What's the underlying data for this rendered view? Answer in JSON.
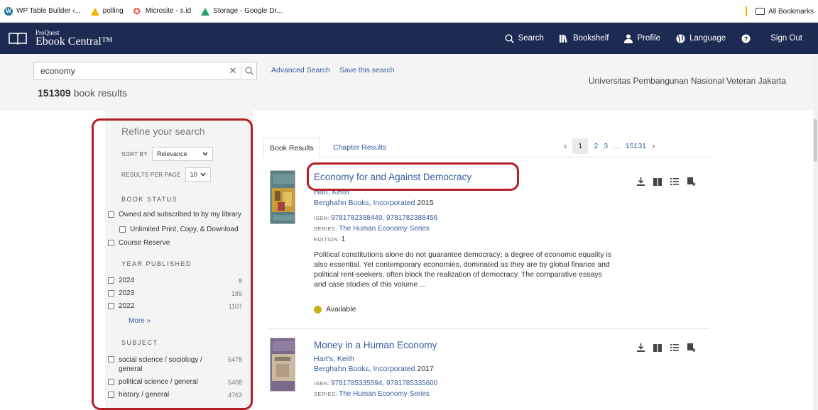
{
  "bookmarks": {
    "items": [
      {
        "label": "WP Table Builder ‹...",
        "icon": "wordpress-icon"
      },
      {
        "label": "polling",
        "icon": "google-drive-icon"
      },
      {
        "label": "Microsite - s.id",
        "icon": "pin-icon"
      },
      {
        "label": "Storage - Google Dr...",
        "icon": "google-drive-icon"
      }
    ],
    "all_bookmarks": "All Bookmarks"
  },
  "header": {
    "brand_small": "ProQuest",
    "brand_big": "Ebook Central™",
    "nav": {
      "search": "Search",
      "bookshelf": "Bookshelf",
      "profile": "Profile",
      "language": "Language",
      "sign_out": "Sign Out"
    },
    "bg_color": "#1d2a52"
  },
  "search": {
    "query": "economy",
    "advanced": "Advanced Search",
    "save": "Save this search",
    "count": "151309",
    "count_suffix": " book results",
    "institution": "Universitas Pembangunan Nasional Veteran Jakarta"
  },
  "refine": {
    "title": "Refine your search",
    "sort_label": "SORT BY",
    "sort_value": "Relevance",
    "rpp_label": "RESULTS PER PAGE",
    "rpp_value": "10",
    "book_status": {
      "heading": "BOOK STATUS",
      "owned": "Owned and subscribed to by my library",
      "unlimited": "Unlimited Print, Copy, & Download",
      "reserve": "Course Reserve"
    },
    "year": {
      "heading": "YEAR PUBLISHED",
      "items": [
        {
          "label": "2024",
          "count": "8"
        },
        {
          "label": "2023",
          "count": "189"
        },
        {
          "label": "2022",
          "count": "1107"
        }
      ],
      "more": "More »"
    },
    "subject": {
      "heading": "SUBJECT",
      "items": [
        {
          "label": "social science / sociology / general",
          "count": "5478"
        },
        {
          "label": "political science / general",
          "count": "5408"
        },
        {
          "label": "history / general",
          "count": "4763"
        }
      ]
    }
  },
  "tabs": {
    "book": "Book Results",
    "chapter": "Chapter Results"
  },
  "pager": {
    "prev": "‹",
    "pages": [
      "1",
      "2",
      "3"
    ],
    "ellipsis": "...",
    "last": "15131",
    "next": "›"
  },
  "results": [
    {
      "title": "Economy for and Against Democracy",
      "author": "Hart, Keith",
      "publisher": "Berghahn Books, Incorporated",
      "year": "2015",
      "isbn_label": "ISBN:",
      "isbn": "9781782388449, 9781782388456",
      "series_label": "SERIES:",
      "series": "The Human Economy Series",
      "edition_label": "EDITION:",
      "edition": "1",
      "description": "Political constitutions alone do not guarantee democracy; a degree of economic equality is also essential. Yet contemporary economies, dominated as they are by global finance and political rent-seekers, often block the realization of democracy. The comparative essays and case studies of this volume ...",
      "availability": "Available"
    },
    {
      "title": "Money in a Human Economy",
      "author": "Hart's, Keith",
      "publisher": "Berghahn Books, Incorporated",
      "year": "2017",
      "isbn_label": "ISBN:",
      "isbn": "9781785335594, 9781785335600",
      "series_label": "SERIES:",
      "series": "The Human Economy Series"
    }
  ],
  "colors": {
    "link": "#3a5ba0",
    "annotation": "#b41e25",
    "available": "#c7b316"
  }
}
